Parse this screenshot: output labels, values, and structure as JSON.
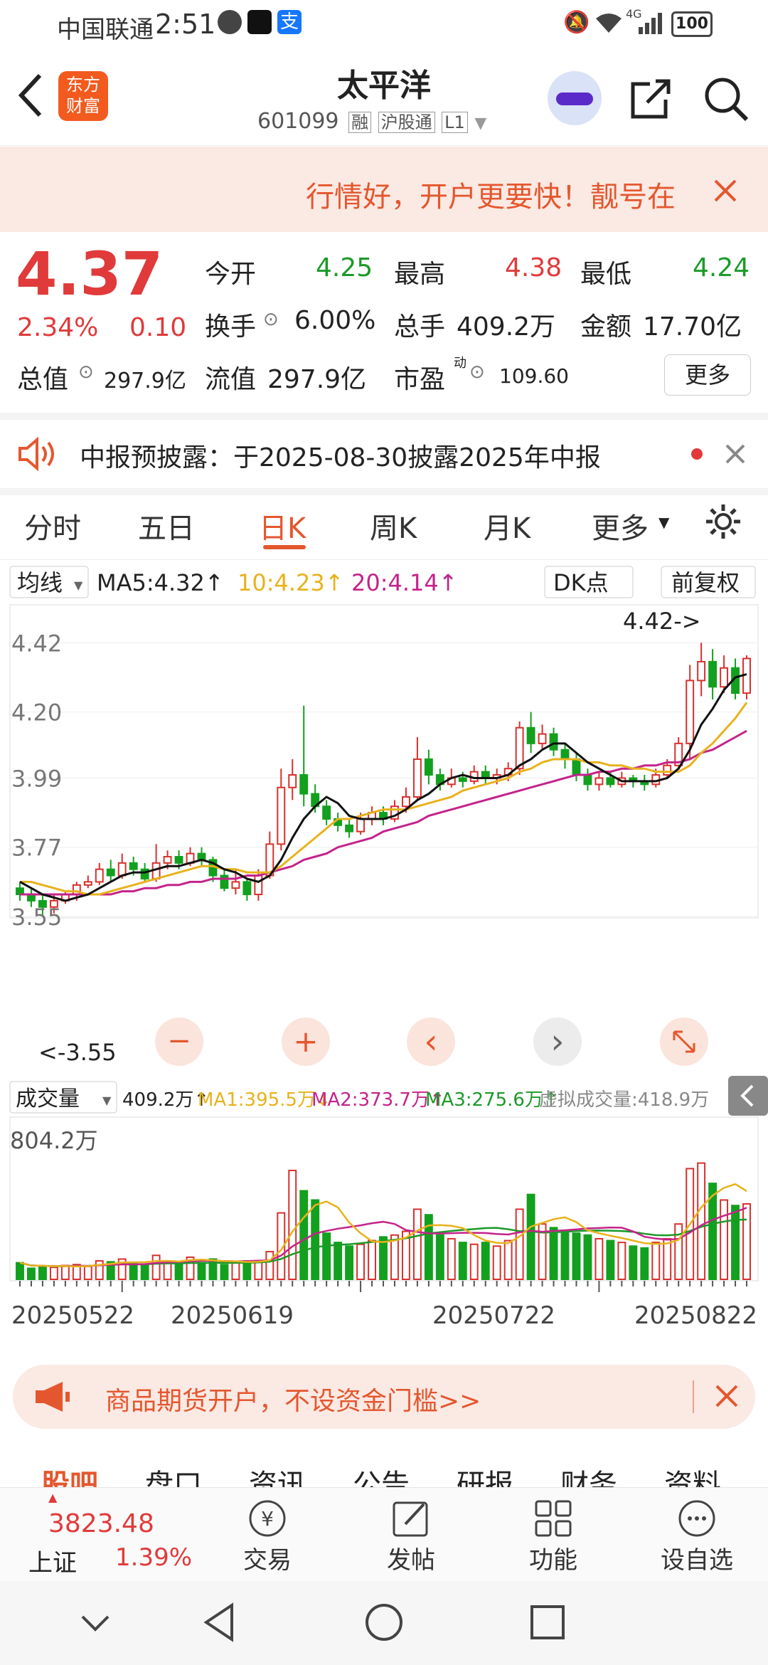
{
  "status_bar": {
    "carrier": "中国联通",
    "time": "2:51",
    "network": "4G",
    "battery": "100"
  },
  "header": {
    "brand": "东方财富",
    "title": "太平洋",
    "code": "601099",
    "tags": [
      "融",
      "沪股通",
      "L1"
    ]
  },
  "promo_banner": {
    "text": "行情好，开户更要快！靓号在"
  },
  "quote": {
    "price": "4.37",
    "change_pct": "2.34%",
    "change": "0.10",
    "open_label": "今开",
    "open": "4.25",
    "high_label": "最高",
    "high": "4.38",
    "low_label": "最低",
    "low": "4.24",
    "turnover_label": "换手",
    "turnover": "6.00%",
    "volume_label": "总手",
    "volume": "409.2万",
    "amount_label": "金额",
    "amount": "17.70亿",
    "mktcap_label": "总值",
    "mktcap": "297.9亿",
    "float_label": "流值",
    "float_value": "297.9亿",
    "pe_label": "市盈",
    "pe_sup": "动",
    "pe": "109.60",
    "more": "更多"
  },
  "notice": {
    "text": "中报预披露：于2025-08-30披露2025年中报"
  },
  "tabs": [
    "分时",
    "五日",
    "日K",
    "周K",
    "月K",
    "更多"
  ],
  "active_tab": "日K",
  "indicator_bar": {
    "selector": "均线",
    "ma5": "MA5:4.32↑",
    "ma10": "10:4.23↑",
    "ma20": "20:4.14↑",
    "dk_button": "DK点",
    "adjust_button": "前复权"
  },
  "chart_data": {
    "type": "candlestick",
    "y_ticks": [
      "4.42",
      "4.20",
      "3.99",
      "3.77",
      "3.55"
    ],
    "ylim": [
      3.55,
      4.5
    ],
    "max_annotation": "4.42->",
    "min_annotation": "<-3.55",
    "dates": [
      "20250522",
      "20250619",
      "20250722",
      "20250822"
    ],
    "candles": [
      [
        3.64,
        3.62,
        3.66,
        3.6
      ],
      [
        3.62,
        3.6,
        3.64,
        3.58
      ],
      [
        3.6,
        3.58,
        3.62,
        3.55
      ],
      [
        3.58,
        3.6,
        3.62,
        3.56
      ],
      [
        3.6,
        3.62,
        3.63,
        3.59
      ],
      [
        3.62,
        3.65,
        3.66,
        3.6
      ],
      [
        3.65,
        3.66,
        3.68,
        3.64
      ],
      [
        3.66,
        3.7,
        3.72,
        3.65
      ],
      [
        3.7,
        3.68,
        3.73,
        3.66
      ],
      [
        3.68,
        3.72,
        3.75,
        3.67
      ],
      [
        3.72,
        3.7,
        3.74,
        3.68
      ],
      [
        3.7,
        3.67,
        3.72,
        3.66
      ],
      [
        3.67,
        3.72,
        3.78,
        3.66
      ],
      [
        3.72,
        3.74,
        3.76,
        3.7
      ],
      [
        3.74,
        3.72,
        3.76,
        3.7
      ],
      [
        3.72,
        3.75,
        3.77,
        3.71
      ],
      [
        3.75,
        3.73,
        3.77,
        3.71
      ],
      [
        3.73,
        3.68,
        3.74,
        3.66
      ],
      [
        3.68,
        3.64,
        3.7,
        3.63
      ],
      [
        3.64,
        3.66,
        3.7,
        3.62
      ],
      [
        3.66,
        3.62,
        3.67,
        3.6
      ],
      [
        3.62,
        3.68,
        3.7,
        3.6
      ],
      [
        3.68,
        3.78,
        3.82,
        3.67
      ],
      [
        3.78,
        3.96,
        4.02,
        3.76
      ],
      [
        3.96,
        4.0,
        4.05,
        3.92
      ],
      [
        4.0,
        3.94,
        4.22,
        3.9
      ],
      [
        3.94,
        3.9,
        3.97,
        3.88
      ],
      [
        3.9,
        3.86,
        3.92,
        3.84
      ],
      [
        3.86,
        3.84,
        3.88,
        3.82
      ],
      [
        3.84,
        3.82,
        3.86,
        3.8
      ],
      [
        3.82,
        3.86,
        3.88,
        3.81
      ],
      [
        3.86,
        3.88,
        3.9,
        3.84
      ],
      [
        3.88,
        3.86,
        3.9,
        3.84
      ],
      [
        3.86,
        3.9,
        3.92,
        3.85
      ],
      [
        3.9,
        3.93,
        3.96,
        3.88
      ],
      [
        3.93,
        4.05,
        4.12,
        3.92
      ],
      [
        4.05,
        4.0,
        4.08,
        3.97
      ],
      [
        4.0,
        3.97,
        4.02,
        3.95
      ],
      [
        3.97,
        3.99,
        4.02,
        3.96
      ],
      [
        3.99,
        3.98,
        4.01,
        3.96
      ],
      [
        3.98,
        4.01,
        4.03,
        3.97
      ],
      [
        4.01,
        3.99,
        4.03,
        3.97
      ],
      [
        3.99,
        4.0,
        4.02,
        3.97
      ],
      [
        4.0,
        4.02,
        4.04,
        3.98
      ],
      [
        4.02,
        4.15,
        4.17,
        4.0
      ],
      [
        4.15,
        4.1,
        4.2,
        4.07
      ],
      [
        4.1,
        4.13,
        4.16,
        4.08
      ],
      [
        4.13,
        4.08,
        4.15,
        4.06
      ],
      [
        4.08,
        4.05,
        4.1,
        4.02
      ],
      [
        4.05,
        4.0,
        4.07,
        3.98
      ],
      [
        4.0,
        3.97,
        4.02,
        3.95
      ],
      [
        3.97,
        3.99,
        4.01,
        3.95
      ],
      [
        3.99,
        3.97,
        4.01,
        3.96
      ],
      [
        3.97,
        3.99,
        4.01,
        3.96
      ],
      [
        3.99,
        3.98,
        4.0,
        3.96
      ],
      [
        3.98,
        3.97,
        4.0,
        3.95
      ],
      [
        3.97,
        4.0,
        4.02,
        3.96
      ],
      [
        4.0,
        4.03,
        4.05,
        3.99
      ],
      [
        4.03,
        4.1,
        4.12,
        4.02
      ],
      [
        4.1,
        4.3,
        4.35,
        4.05
      ],
      [
        4.3,
        4.36,
        4.42,
        4.25
      ],
      [
        4.36,
        4.28,
        4.4,
        4.24
      ],
      [
        4.28,
        4.34,
        4.38,
        4.26
      ],
      [
        4.34,
        4.26,
        4.37,
        4.24
      ],
      [
        4.26,
        4.37,
        4.38,
        4.24
      ]
    ],
    "ma5": [
      3.66,
      3.64,
      3.62,
      3.61,
      3.6,
      3.61,
      3.62,
      3.64,
      3.66,
      3.68,
      3.69,
      3.69,
      3.7,
      3.71,
      3.71,
      3.72,
      3.73,
      3.72,
      3.7,
      3.69,
      3.67,
      3.66,
      3.68,
      3.73,
      3.8,
      3.86,
      3.9,
      3.93,
      3.91,
      3.87,
      3.86,
      3.86,
      3.86,
      3.87,
      3.89,
      3.92,
      3.94,
      3.97,
      3.99,
      4.0,
      3.99,
      3.99,
      3.99,
      4.0,
      4.03,
      4.05,
      4.08,
      4.1,
      4.1,
      4.07,
      4.04,
      4.02,
      4.0,
      3.98,
      3.98,
      3.98,
      3.98,
      3.99,
      4.02,
      4.08,
      4.16,
      4.21,
      4.27,
      4.31,
      4.32
    ],
    "ma10": [
      3.66,
      3.66,
      3.65,
      3.64,
      3.63,
      3.63,
      3.62,
      3.62,
      3.63,
      3.64,
      3.65,
      3.66,
      3.67,
      3.68,
      3.69,
      3.7,
      3.71,
      3.71,
      3.7,
      3.7,
      3.69,
      3.69,
      3.69,
      3.71,
      3.74,
      3.77,
      3.8,
      3.83,
      3.86,
      3.86,
      3.87,
      3.88,
      3.89,
      3.89,
      3.89,
      3.9,
      3.91,
      3.92,
      3.93,
      3.95,
      3.96,
      3.97,
      3.98,
      3.99,
      4.01,
      4.02,
      4.04,
      4.05,
      4.05,
      4.05,
      4.04,
      4.04,
      4.03,
      4.03,
      4.02,
      4.02,
      4.01,
      4.01,
      4.01,
      4.03,
      4.07,
      4.1,
      4.14,
      4.18,
      4.23
    ],
    "ma20": [
      3.62,
      3.62,
      3.62,
      3.62,
      3.62,
      3.62,
      3.62,
      3.62,
      3.62,
      3.63,
      3.63,
      3.64,
      3.64,
      3.65,
      3.65,
      3.66,
      3.66,
      3.67,
      3.67,
      3.67,
      3.68,
      3.68,
      3.69,
      3.7,
      3.71,
      3.73,
      3.74,
      3.75,
      3.77,
      3.78,
      3.79,
      3.8,
      3.82,
      3.83,
      3.84,
      3.85,
      3.87,
      3.88,
      3.89,
      3.9,
      3.91,
      3.92,
      3.93,
      3.94,
      3.95,
      3.96,
      3.97,
      3.98,
      3.99,
      4.0,
      4.0,
      4.01,
      4.01,
      4.02,
      4.02,
      4.03,
      4.03,
      4.04,
      4.04,
      4.05,
      4.07,
      4.08,
      4.1,
      4.12,
      4.14
    ],
    "volume_bar": {
      "selector": "成交量",
      "vol": "409.2万↑",
      "ma1": "MA1:395.5万↓",
      "ma2": "MA2:373.7万↑",
      "ma3": "MA3:275.6万↑",
      "virtual": "虚拟成交量:418.9万",
      "max_label": "804.2万"
    },
    "volumes": [
      90,
      60,
      70,
      65,
      75,
      80,
      70,
      100,
      95,
      110,
      85,
      75,
      130,
      100,
      95,
      120,
      90,
      110,
      80,
      90,
      100,
      95,
      150,
      360,
      590,
      480,
      430,
      250,
      200,
      180,
      190,
      210,
      230,
      240,
      260,
      380,
      350,
      240,
      220,
      200,
      190,
      200,
      180,
      210,
      380,
      460,
      300,
      280,
      260,
      250,
      240,
      220,
      210,
      200,
      180,
      170,
      200,
      220,
      300,
      600,
      630,
      520,
      430,
      400,
      409
    ]
  },
  "chart_controls": {
    "zoom_out": "−",
    "zoom_in": "+",
    "prev": "‹",
    "next": "›",
    "expand": "expand-icon"
  },
  "ad_bar": {
    "text": "商品期货开户，不设资金门槛>>"
  },
  "bottom_tabs": [
    "股吧",
    "盘口",
    "资讯",
    "公告",
    "研报",
    "财务",
    "资料"
  ],
  "bottom_nav": {
    "index_value": "3823.48",
    "index_name": "上证",
    "index_pct": "1.39%",
    "items": [
      "交易",
      "发帖",
      "功能",
      "设自选"
    ]
  }
}
